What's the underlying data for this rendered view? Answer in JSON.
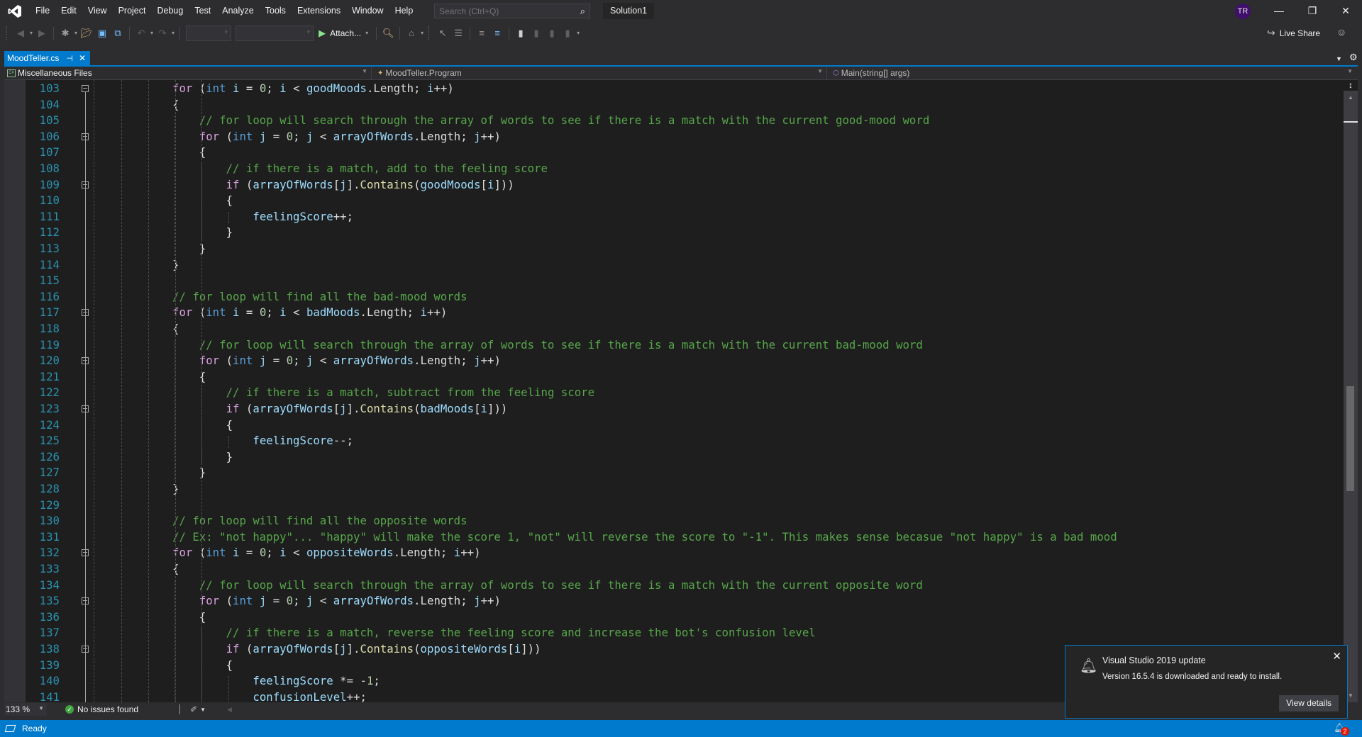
{
  "titlebar": {
    "menu": [
      "File",
      "Edit",
      "View",
      "Project",
      "Debug",
      "Test",
      "Analyze",
      "Tools",
      "Extensions",
      "Window",
      "Help"
    ],
    "search_placeholder": "Search (Ctrl+Q)",
    "solution_name": "Solution1",
    "user_initials": "TR",
    "window_controls": [
      "minimize",
      "restore",
      "close"
    ]
  },
  "toolbar": {
    "attach_label": "Attach...",
    "live_share_label": "Live Share"
  },
  "tabs": [
    {
      "label": "MoodTeller.cs",
      "active": true
    }
  ],
  "navbar": {
    "project": "Miscellaneous Files",
    "type": "MoodTeller.Program",
    "member": "Main(string[] args)"
  },
  "editor": {
    "language": "C#",
    "colors": {
      "keyword": "#569cd6",
      "control": "#d8a0df",
      "variable": "#9cdcfe",
      "method": "#dcdcaa",
      "number": "#b5cea8",
      "comment": "#57a64a",
      "line_number": "#2b91af"
    },
    "lines": [
      {
        "n": "103",
        "indent": 0,
        "fold": true,
        "tokens": [
          [
            "ctl",
            "for"
          ],
          [
            "p",
            " ("
          ],
          [
            "kw",
            "int"
          ],
          [
            "p",
            " "
          ],
          [
            "var",
            "i"
          ],
          [
            "p",
            " = "
          ],
          [
            "num",
            "0"
          ],
          [
            "p",
            "; "
          ],
          [
            "var",
            "i"
          ],
          [
            "p",
            " < "
          ],
          [
            "var",
            "goodMoods"
          ],
          [
            "p",
            ".Length; "
          ],
          [
            "var",
            "i"
          ],
          [
            "p",
            "++)"
          ]
        ]
      },
      {
        "n": "104",
        "indent": 0,
        "tokens": [
          [
            "p",
            "{"
          ]
        ]
      },
      {
        "n": "105",
        "indent": 1,
        "tokens": [
          [
            "cmt",
            "// for loop will search through the array of words to see if there is a match with the current good-mood word"
          ]
        ]
      },
      {
        "n": "106",
        "indent": 1,
        "fold": true,
        "tokens": [
          [
            "ctl",
            "for"
          ],
          [
            "p",
            " ("
          ],
          [
            "kw",
            "int"
          ],
          [
            "p",
            " "
          ],
          [
            "var",
            "j"
          ],
          [
            "p",
            " = "
          ],
          [
            "num",
            "0"
          ],
          [
            "p",
            "; "
          ],
          [
            "var",
            "j"
          ],
          [
            "p",
            " < "
          ],
          [
            "var",
            "arrayOfWords"
          ],
          [
            "p",
            ".Length; "
          ],
          [
            "var",
            "j"
          ],
          [
            "p",
            "++)"
          ]
        ]
      },
      {
        "n": "107",
        "indent": 1,
        "tokens": [
          [
            "p",
            "{"
          ]
        ]
      },
      {
        "n": "108",
        "indent": 2,
        "tokens": [
          [
            "cmt",
            "// if there is a match, add to the feeling score"
          ]
        ]
      },
      {
        "n": "109",
        "indent": 2,
        "fold": true,
        "tokens": [
          [
            "ctl",
            "if"
          ],
          [
            "p",
            " ("
          ],
          [
            "var",
            "arrayOfWords"
          ],
          [
            "p",
            "["
          ],
          [
            "var",
            "j"
          ],
          [
            "p",
            "]."
          ],
          [
            "meth",
            "Contains"
          ],
          [
            "p",
            "("
          ],
          [
            "var",
            "goodMoods"
          ],
          [
            "p",
            "["
          ],
          [
            "var",
            "i"
          ],
          [
            "p",
            "]))"
          ]
        ]
      },
      {
        "n": "110",
        "indent": 2,
        "tokens": [
          [
            "p",
            "{"
          ]
        ]
      },
      {
        "n": "111",
        "indent": 3,
        "tokens": [
          [
            "var",
            "feelingScore"
          ],
          [
            "p",
            "++;"
          ]
        ]
      },
      {
        "n": "112",
        "indent": 2,
        "tokens": [
          [
            "p",
            "}"
          ]
        ]
      },
      {
        "n": "113",
        "indent": 1,
        "tokens": [
          [
            "p",
            "}"
          ]
        ]
      },
      {
        "n": "114",
        "indent": 0,
        "tokens": [
          [
            "p",
            "}"
          ]
        ]
      },
      {
        "n": "115",
        "indent": 0,
        "tokens": []
      },
      {
        "n": "116",
        "indent": 0,
        "tokens": [
          [
            "cmt",
            "// for loop will find all the bad-mood words"
          ]
        ]
      },
      {
        "n": "117",
        "indent": 0,
        "fold": true,
        "tokens": [
          [
            "ctl",
            "for"
          ],
          [
            "p",
            " ("
          ],
          [
            "kw",
            "int"
          ],
          [
            "p",
            " "
          ],
          [
            "var",
            "i"
          ],
          [
            "p",
            " = "
          ],
          [
            "num",
            "0"
          ],
          [
            "p",
            "; "
          ],
          [
            "var",
            "i"
          ],
          [
            "p",
            " < "
          ],
          [
            "var",
            "badMoods"
          ],
          [
            "p",
            ".Length; "
          ],
          [
            "var",
            "i"
          ],
          [
            "p",
            "++)"
          ]
        ]
      },
      {
        "n": "118",
        "indent": 0,
        "tokens": [
          [
            "p",
            "{"
          ]
        ]
      },
      {
        "n": "119",
        "indent": 1,
        "tokens": [
          [
            "cmt",
            "// for loop will search through the array of words to see if there is a match with the current bad-mood word"
          ]
        ]
      },
      {
        "n": "120",
        "indent": 1,
        "fold": true,
        "tokens": [
          [
            "ctl",
            "for"
          ],
          [
            "p",
            " ("
          ],
          [
            "kw",
            "int"
          ],
          [
            "p",
            " "
          ],
          [
            "var",
            "j"
          ],
          [
            "p",
            " = "
          ],
          [
            "num",
            "0"
          ],
          [
            "p",
            "; "
          ],
          [
            "var",
            "j"
          ],
          [
            "p",
            " < "
          ],
          [
            "var",
            "arrayOfWords"
          ],
          [
            "p",
            ".Length; "
          ],
          [
            "var",
            "j"
          ],
          [
            "p",
            "++)"
          ]
        ]
      },
      {
        "n": "121",
        "indent": 1,
        "tokens": [
          [
            "p",
            "{"
          ]
        ]
      },
      {
        "n": "122",
        "indent": 2,
        "tokens": [
          [
            "cmt",
            "// if there is a match, subtract from the feeling score"
          ]
        ]
      },
      {
        "n": "123",
        "indent": 2,
        "fold": true,
        "tokens": [
          [
            "ctl",
            "if"
          ],
          [
            "p",
            " ("
          ],
          [
            "var",
            "arrayOfWords"
          ],
          [
            "p",
            "["
          ],
          [
            "var",
            "j"
          ],
          [
            "p",
            "]."
          ],
          [
            "meth",
            "Contains"
          ],
          [
            "p",
            "("
          ],
          [
            "var",
            "badMoods"
          ],
          [
            "p",
            "["
          ],
          [
            "var",
            "i"
          ],
          [
            "p",
            "]))"
          ]
        ]
      },
      {
        "n": "124",
        "indent": 2,
        "tokens": [
          [
            "p",
            "{"
          ]
        ]
      },
      {
        "n": "125",
        "indent": 3,
        "tokens": [
          [
            "var",
            "feelingScore"
          ],
          [
            "p",
            "--;"
          ]
        ]
      },
      {
        "n": "126",
        "indent": 2,
        "tokens": [
          [
            "p",
            "}"
          ]
        ]
      },
      {
        "n": "127",
        "indent": 1,
        "tokens": [
          [
            "p",
            "}"
          ]
        ]
      },
      {
        "n": "128",
        "indent": 0,
        "tokens": [
          [
            "p",
            "}"
          ]
        ]
      },
      {
        "n": "129",
        "indent": 0,
        "tokens": []
      },
      {
        "n": "130",
        "indent": 0,
        "tokens": [
          [
            "cmt",
            "// for loop will find all the opposite words"
          ]
        ]
      },
      {
        "n": "131",
        "indent": 0,
        "tokens": [
          [
            "cmt",
            "// Ex: \"not happy\"... \"happy\" will make the score 1, \"not\" will reverse the score to \"-1\". This makes sense becasue \"not happy\" is a bad mood"
          ]
        ]
      },
      {
        "n": "132",
        "indent": 0,
        "fold": true,
        "tokens": [
          [
            "ctl",
            "for"
          ],
          [
            "p",
            " ("
          ],
          [
            "kw",
            "int"
          ],
          [
            "p",
            " "
          ],
          [
            "var",
            "i"
          ],
          [
            "p",
            " = "
          ],
          [
            "num",
            "0"
          ],
          [
            "p",
            "; "
          ],
          [
            "var",
            "i"
          ],
          [
            "p",
            " < "
          ],
          [
            "var",
            "oppositeWords"
          ],
          [
            "p",
            ".Length; "
          ],
          [
            "var",
            "i"
          ],
          [
            "p",
            "++)"
          ]
        ]
      },
      {
        "n": "133",
        "indent": 0,
        "tokens": [
          [
            "p",
            "{"
          ]
        ]
      },
      {
        "n": "134",
        "indent": 1,
        "tokens": [
          [
            "cmt",
            "// for loop will search through the array of words to see if there is a match with the current opposite word"
          ]
        ]
      },
      {
        "n": "135",
        "indent": 1,
        "fold": true,
        "tokens": [
          [
            "ctl",
            "for"
          ],
          [
            "p",
            " ("
          ],
          [
            "kw",
            "int"
          ],
          [
            "p",
            " "
          ],
          [
            "var",
            "j"
          ],
          [
            "p",
            " = "
          ],
          [
            "num",
            "0"
          ],
          [
            "p",
            "; "
          ],
          [
            "var",
            "j"
          ],
          [
            "p",
            " < "
          ],
          [
            "var",
            "arrayOfWords"
          ],
          [
            "p",
            ".Length; "
          ],
          [
            "var",
            "j"
          ],
          [
            "p",
            "++)"
          ]
        ]
      },
      {
        "n": "136",
        "indent": 1,
        "tokens": [
          [
            "p",
            "{"
          ]
        ]
      },
      {
        "n": "137",
        "indent": 2,
        "tokens": [
          [
            "cmt",
            "// if there is a match, reverse the feeling score and increase the bot's confusion level"
          ]
        ]
      },
      {
        "n": "138",
        "indent": 2,
        "fold": true,
        "tokens": [
          [
            "ctl",
            "if"
          ],
          [
            "p",
            " ("
          ],
          [
            "var",
            "arrayOfWords"
          ],
          [
            "p",
            "["
          ],
          [
            "var",
            "j"
          ],
          [
            "p",
            "]."
          ],
          [
            "meth",
            "Contains"
          ],
          [
            "p",
            "("
          ],
          [
            "var",
            "oppositeWords"
          ],
          [
            "p",
            "["
          ],
          [
            "var",
            "i"
          ],
          [
            "p",
            "]))"
          ]
        ]
      },
      {
        "n": "139",
        "indent": 2,
        "tokens": [
          [
            "p",
            "{"
          ]
        ]
      },
      {
        "n": "140",
        "indent": 3,
        "tokens": [
          [
            "var",
            "feelingScore"
          ],
          [
            "p",
            " *= -"
          ],
          [
            "num",
            "1"
          ],
          [
            "p",
            ";"
          ]
        ]
      },
      {
        "n": "141",
        "indent": 3,
        "tokens": [
          [
            "var",
            "confusionLevel"
          ],
          [
            "p",
            "++;"
          ]
        ]
      }
    ]
  },
  "editor_status": {
    "zoom": "133 %",
    "issues": "No issues found"
  },
  "statusbar": {
    "text": "Ready",
    "notification_count": "2"
  },
  "notification": {
    "title": "Visual Studio 2019 update",
    "message": "Version 16.5.4 is downloaded and ready to install.",
    "button": "View details"
  }
}
